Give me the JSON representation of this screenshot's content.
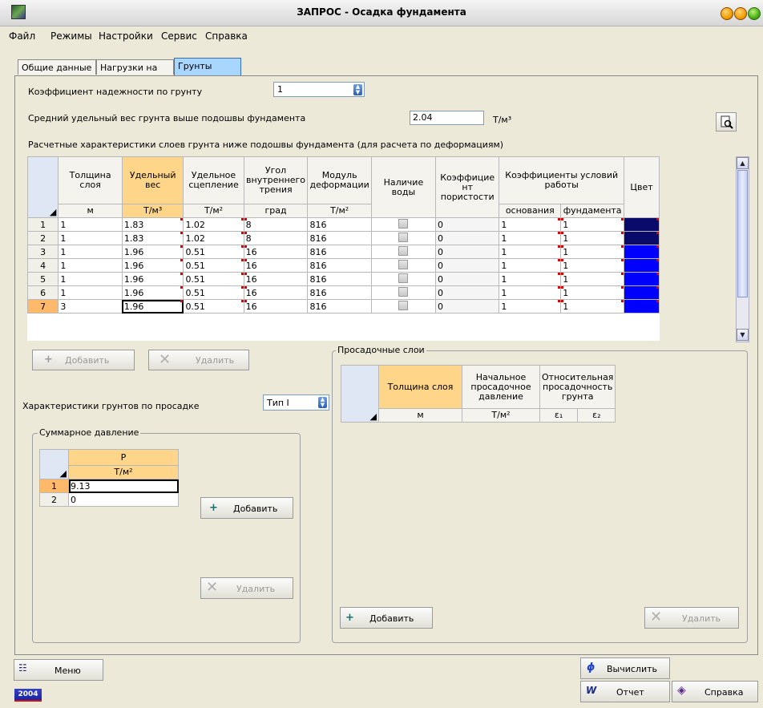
{
  "window": {
    "title": "ЗАПРОС - Осадка фундамента"
  },
  "menu": [
    "Файл",
    "Режимы",
    "Настройки",
    "Сервис",
    "Справка"
  ],
  "tabs": [
    "Общие данные",
    "Нагрузки на пол",
    "Грунты"
  ],
  "reliability": {
    "label": "Коэффициент надежности по грунту",
    "value": "1"
  },
  "avg_weight": {
    "label": "Средний удельный вес грунта выше подошвы фундамента",
    "value": "2.04",
    "unit": "Т/м³"
  },
  "layers_title": "Расчетные характеристики слоев грунта ниже подошвы фундамента (для расчета по деформациям)",
  "layers": {
    "headers": {
      "thickness": "Толщина слоя",
      "weight": "Удельный вес",
      "cohesion": "Удельное сцепление",
      "angle": "Угол внутреннего трения",
      "modulus": "Модуль деформации",
      "water": "Наличие воды",
      "porosity": "Коэффицие нт пористости",
      "conditions": "Коэффициенты условий работы",
      "color": "Цвет"
    },
    "units": {
      "thickness": "м",
      "weight": "Т/м³",
      "cohesion": "Т/м²",
      "angle": "град",
      "modulus": "Т/м²",
      "base": "основания",
      "foundation": "фундамента"
    },
    "rows": [
      {
        "n": "1",
        "thickness": "1",
        "weight": "1.83",
        "cohesion": "1.02",
        "angle": "8",
        "modulus": "816",
        "porosity": "0",
        "base": "1",
        "foundation": "1",
        "color": "#0a0a6a"
      },
      {
        "n": "2",
        "thickness": "1",
        "weight": "1.83",
        "cohesion": "1.02",
        "angle": "8",
        "modulus": "816",
        "porosity": "0",
        "base": "1",
        "foundation": "1",
        "color": "#0a0a6a"
      },
      {
        "n": "3",
        "thickness": "1",
        "weight": "1.96",
        "cohesion": "0.51",
        "angle": "16",
        "modulus": "816",
        "porosity": "0",
        "base": "1",
        "foundation": "1",
        "color": "#0000ff"
      },
      {
        "n": "4",
        "thickness": "1",
        "weight": "1.96",
        "cohesion": "0.51",
        "angle": "16",
        "modulus": "816",
        "porosity": "0",
        "base": "1",
        "foundation": "1",
        "color": "#0000ff"
      },
      {
        "n": "5",
        "thickness": "1",
        "weight": "1.96",
        "cohesion": "0.51",
        "angle": "16",
        "modulus": "816",
        "porosity": "0",
        "base": "1",
        "foundation": "1",
        "color": "#0000ff"
      },
      {
        "n": "6",
        "thickness": "1",
        "weight": "1.96",
        "cohesion": "0.51",
        "angle": "16",
        "modulus": "816",
        "porosity": "0",
        "base": "1",
        "foundation": "1",
        "color": "#0000ff"
      },
      {
        "n": "7",
        "thickness": "3",
        "weight": "1.96",
        "cohesion": "0.51",
        "angle": "16",
        "modulus": "816",
        "porosity": "0",
        "base": "1",
        "foundation": "1",
        "color": "#0000ff"
      }
    ]
  },
  "buttons": {
    "add": "Добавить",
    "delete": "Удалить"
  },
  "subsidence": {
    "label": "Характеристики грунтов по просадке",
    "value": "Тип I"
  },
  "pressure": {
    "title": "Суммарное давление",
    "header": "P",
    "unit": "Т/м²",
    "rows": [
      {
        "n": "1",
        "value": "9.13"
      },
      {
        "n": "2",
        "value": "0"
      }
    ]
  },
  "subs_layers": {
    "title": "Просадочные слои",
    "headers": {
      "thickness": "Толщина слоя",
      "initial": "Начальное просадочное давление",
      "relative": "Относительная просадочность грунта"
    },
    "units": {
      "thickness": "м",
      "initial": "Т/м²",
      "e1": "ε₁",
      "e2": "ε₂"
    }
  },
  "bottom": {
    "menu": "Меню",
    "calc": "Вычислить",
    "report": "Отчет",
    "help": "Справка",
    "year": "2004"
  }
}
